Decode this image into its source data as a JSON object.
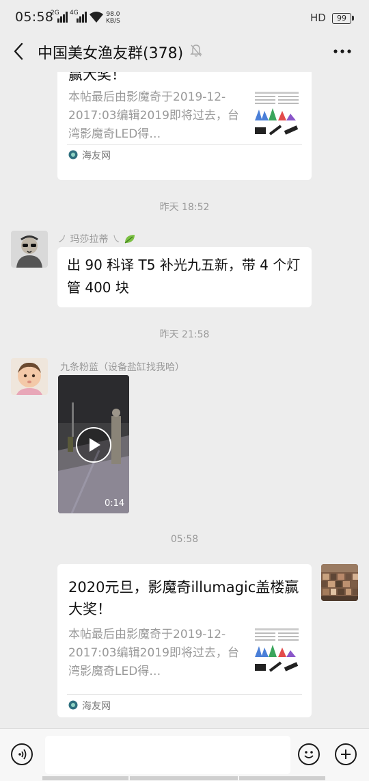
{
  "status_bar": {
    "time": "05:58",
    "network1": "2G",
    "network2": "4G",
    "speed_value": "98.0",
    "speed_unit": "KB/S",
    "hd": "HD",
    "battery": "99"
  },
  "header": {
    "title": "中国美女渔友群(378)"
  },
  "messages": {
    "card1": {
      "title_partial": "赢大奖！",
      "desc": "本帖最后由影魔奇于2019-12-2017:03编辑2019即将过去，台湾影魔奇LED得…",
      "source": "海友网"
    },
    "timestamp1": "昨天 18:52",
    "msg1": {
      "sender": "玛莎拉蒂",
      "text": "出 90 科译 T5 补光九五新，带 4 个灯管 400 块"
    },
    "timestamp2": "昨天 21:58",
    "msg2": {
      "sender": "九条粉蓝（设备盐缸找我哈）",
      "video_duration": "0:14"
    },
    "timestamp3": "05:58",
    "card2": {
      "title": "2020元旦，影魔奇illumagic盖楼赢大奖！",
      "desc": "本帖最后由影魔奇于2019-12-2017:03编辑2019即将过去，台湾影魔奇LED得…",
      "source": "海友网"
    }
  },
  "input_bar": {
    "placeholder": ""
  },
  "colors": {
    "background": "#ededed",
    "bubble": "#ffffff",
    "meta_text": "#999999"
  }
}
